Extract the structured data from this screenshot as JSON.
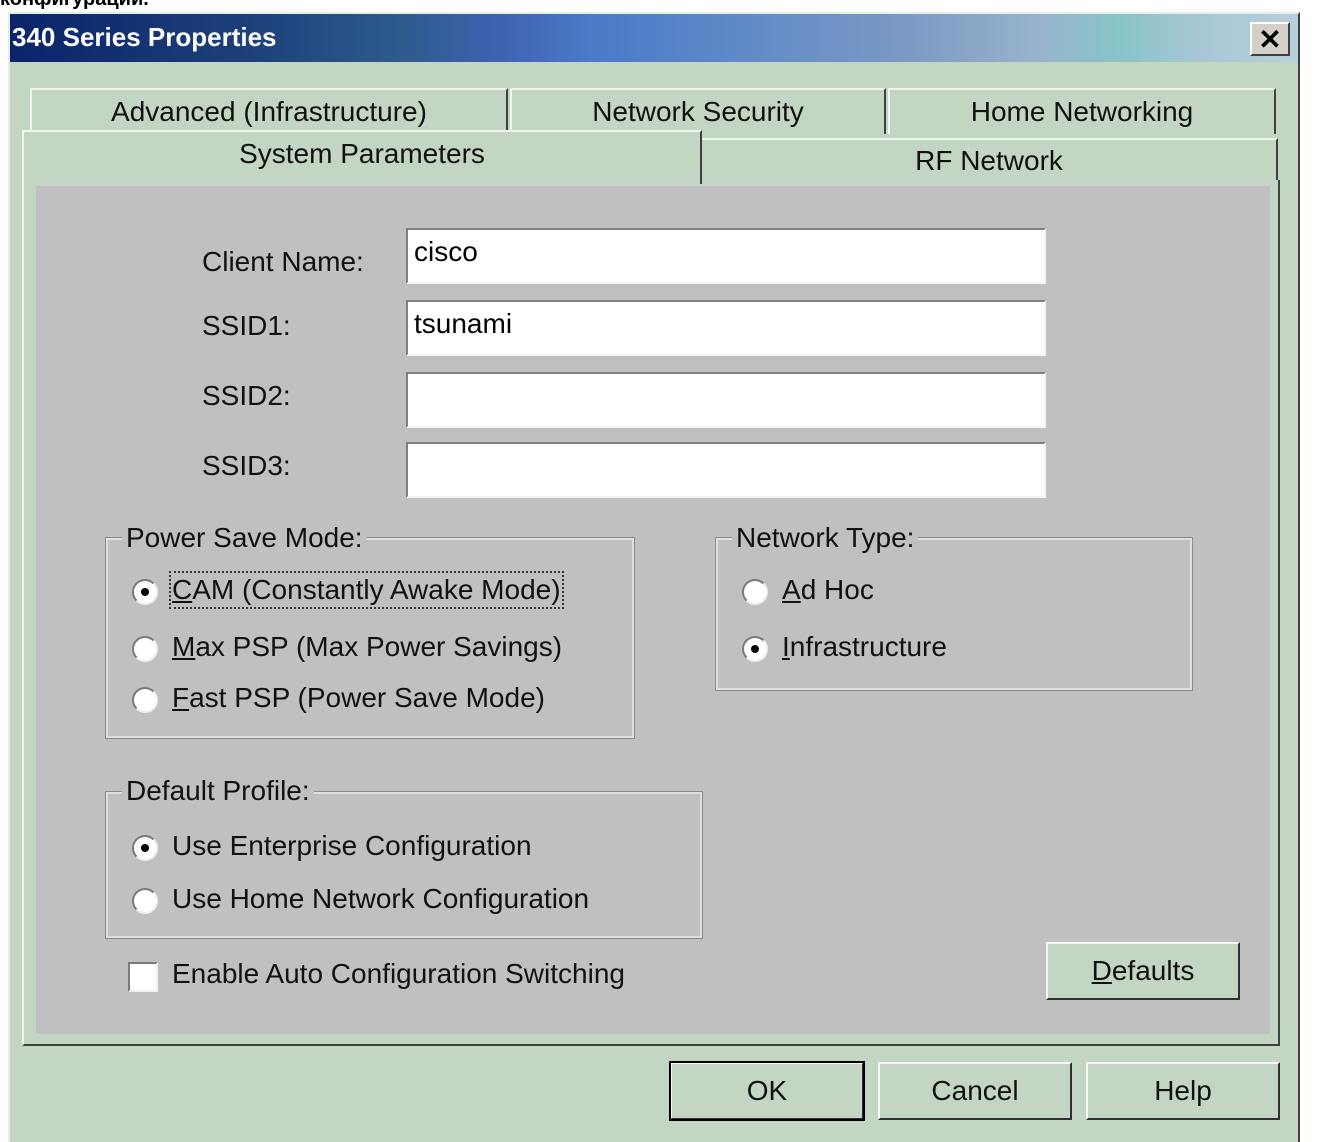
{
  "caption": "конфигурации.",
  "window": {
    "title": "340 Series Properties",
    "close_glyph": "✕"
  },
  "tabs": {
    "row1": [
      "Advanced (Infrastructure)",
      "Network Security",
      "Home Networking"
    ],
    "row2": [
      "System Parameters",
      "RF Network"
    ],
    "active": "System Parameters"
  },
  "fields": {
    "client_name": {
      "label": "Client Name:",
      "value": "cisco"
    },
    "ssid1": {
      "label": "SSID1:",
      "value": "tsunami"
    },
    "ssid2": {
      "label": "SSID2:",
      "value": ""
    },
    "ssid3": {
      "label": "SSID3:",
      "value": ""
    }
  },
  "power_save": {
    "legend": "Power Save Mode:",
    "options": [
      {
        "access": "C",
        "rest": "AM (Constantly Awake Mode)",
        "checked": true
      },
      {
        "access": "M",
        "rest": "ax PSP (Max Power Savings)",
        "checked": false
      },
      {
        "access": "F",
        "rest": "ast PSP (Power Save Mode)",
        "checked": false
      }
    ]
  },
  "network_type": {
    "legend": "Network Type:",
    "options": [
      {
        "access": "A",
        "rest": "d Hoc",
        "checked": false
      },
      {
        "access": "I",
        "rest": "nfrastructure",
        "checked": true
      }
    ]
  },
  "default_profile": {
    "legend": "Default Profile:",
    "options": [
      {
        "label": "Use Enterprise Configuration",
        "checked": true
      },
      {
        "label": "Use Home Network Configuration",
        "checked": false
      }
    ]
  },
  "auto_switch": {
    "label": "Enable Auto Configuration Switching",
    "checked": false
  },
  "buttons": {
    "defaults_access": "D",
    "defaults_rest": "efaults",
    "ok": "OK",
    "cancel": "Cancel",
    "help": "Help"
  }
}
